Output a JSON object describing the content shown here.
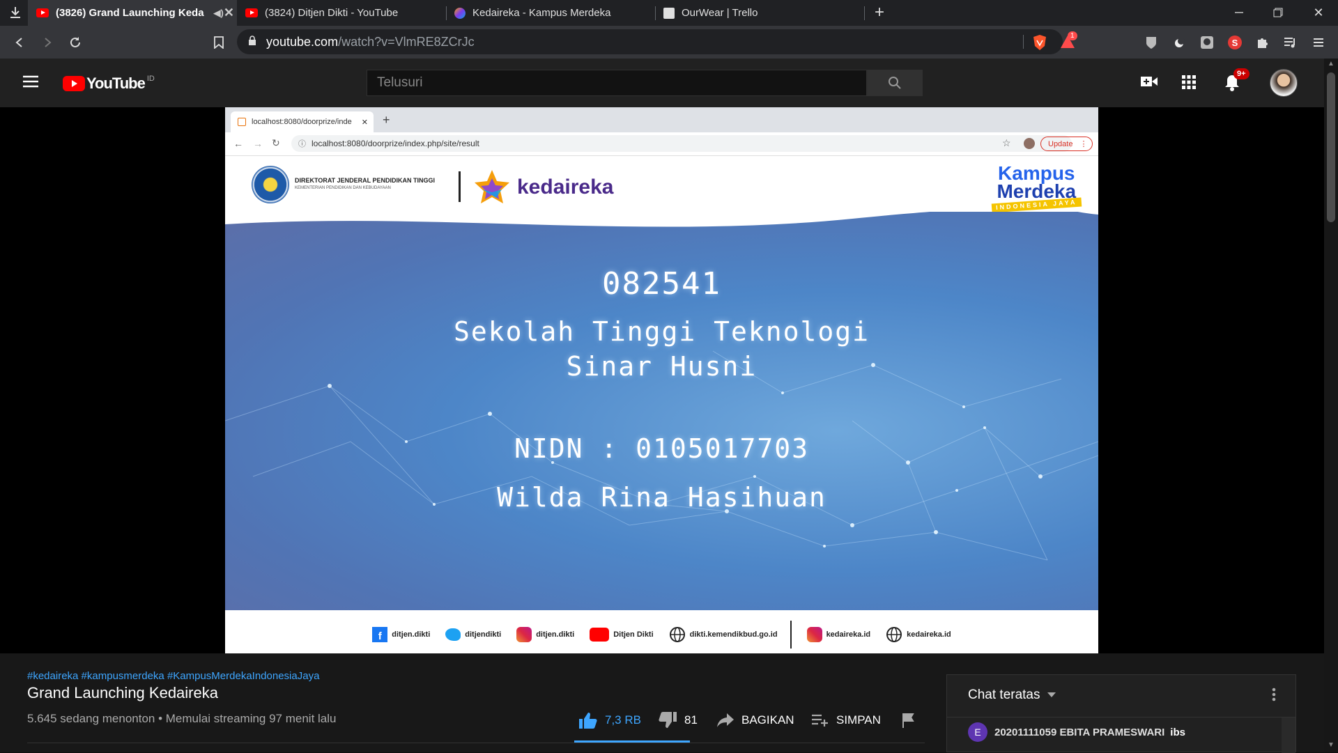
{
  "browser": {
    "tabs": [
      {
        "title": "(3826) Grand Launching Keda",
        "favicon": "youtube",
        "active": true
      },
      {
        "title": "(3824) Ditjen Dikti - YouTube",
        "favicon": "youtube",
        "active": false
      },
      {
        "title": "Kedaireka - Kampus Merdeka",
        "favicon": "kedaireka",
        "active": false
      },
      {
        "title": "OurWear | Trello",
        "favicon": "trello",
        "active": false
      }
    ],
    "address": {
      "host": "youtube.com",
      "path": "/watch?v=VlmRE8ZCrJc"
    },
    "brave_badge": "1"
  },
  "youtube": {
    "logo_text": "YouTube",
    "region": "ID",
    "search_placeholder": "Telusuri",
    "notification_badge": "9+"
  },
  "video": {
    "inner_tab_title": "localhost:8080/doorprize/inde",
    "inner_url": "localhost:8080/doorprize/index.php/site/result",
    "inner_update_label": "Update",
    "header_left_line1": "DIREKTORAT JENDERAL PENDIDIKAN TINGGI",
    "header_left_line2": "KEMENTERIAN PENDIDIKAN DAN KEBUDAYAAN",
    "kedaireka_label": "kedaireka",
    "kampus_line1": "Kampus",
    "kampus_line2": "Merdeka",
    "kampus_line3": "INDONESIA JAYA",
    "number": "082541",
    "institution_line1": "Sekolah Tinggi Teknologi",
    "institution_line2": "Sinar Husni",
    "nidn": "NIDN : 0105017703",
    "name": "Wilda Rina Hasihuan",
    "footer": [
      {
        "icon": "facebook-icon",
        "label": "ditjen.dikti"
      },
      {
        "icon": "twitter-icon",
        "label": "ditjendikti"
      },
      {
        "icon": "instagram-icon",
        "label": "ditjen.dikti"
      },
      {
        "icon": "youtube-icon",
        "label": "Ditjen Dikti"
      },
      {
        "icon": "globe-icon",
        "label": "dikti.kemendikbud.go.id"
      },
      {
        "icon": "instagram-icon",
        "label": "kedaireka.id"
      },
      {
        "icon": "globe-icon",
        "label": "kedaireka.id"
      }
    ]
  },
  "info": {
    "hashtags": "#kedaireka #kampusmerdeka #KampusMerdekaIndonesiaJaya",
    "title": "Grand Launching Kedaireka",
    "meta": "5.645 sedang menonton • Memulai streaming 97 menit lalu",
    "likes": "7,3 RB",
    "dislikes": "81",
    "share_label": "BAGIKAN",
    "save_label": "SIMPAN"
  },
  "chat": {
    "header": "Chat teratas",
    "message_avatar": "E",
    "message_author": "20201111059 EBITA PRAMESWARI",
    "message_text": "ibs"
  },
  "colors": {
    "accent_blue": "#3ea6ff",
    "youtube_red": "#ff0000"
  }
}
